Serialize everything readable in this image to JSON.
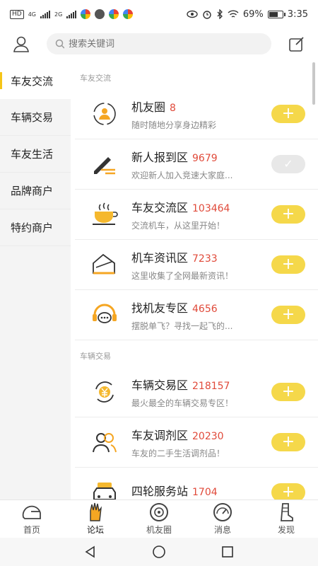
{
  "status_bar": {
    "left_chips": [
      "HD",
      "4G",
      "2G"
    ],
    "battery": "69%",
    "battery_level": 0.69,
    "time": "3:35"
  },
  "search": {
    "placeholder": "搜索关键词"
  },
  "sidebar": {
    "items": [
      {
        "label": "车友交流",
        "active": true
      },
      {
        "label": "车辆交易",
        "active": false
      },
      {
        "label": "车友生活",
        "active": false
      },
      {
        "label": "品牌商户",
        "active": false
      },
      {
        "label": "特约商户",
        "active": false
      }
    ]
  },
  "sections": [
    {
      "title": "车友交流",
      "rows": [
        {
          "name": "机友圈",
          "count": "8",
          "desc": "随时随地分享身边精彩",
          "icon": "users-circle-icon",
          "joined": false
        },
        {
          "name": "新人报到区",
          "count": "9679",
          "desc": "欢迎新人加入竞速大家庭...",
          "icon": "pencil-icon",
          "joined": true
        },
        {
          "name": "车友交流区",
          "count": "103464",
          "desc": "交流机车，从这里开始！",
          "icon": "coffee-cup-icon",
          "joined": false
        },
        {
          "name": "机车资讯区",
          "count": "7233",
          "desc": "这里收集了全网最新资讯！",
          "icon": "envelope-icon",
          "joined": false
        },
        {
          "name": "找机友专区",
          "count": "4656",
          "desc": "摆脱单飞？寻找一起飞的...",
          "icon": "chat-headset-icon",
          "joined": false
        }
      ]
    },
    {
      "title": "车辆交易",
      "rows": [
        {
          "name": "车辆交易区",
          "count": "218157",
          "desc": "最火最全的车辆交易专区！",
          "icon": "yen-exchange-icon",
          "joined": false
        },
        {
          "name": "车友调剂区",
          "count": "20230",
          "desc": "车友的二手生活调剂品！",
          "icon": "two-users-icon",
          "joined": false
        },
        {
          "name": "四轮服务站",
          "count": "1704",
          "desc": "",
          "icon": "car-icon",
          "joined": false
        }
      ]
    }
  ],
  "buttons": {
    "add": "+",
    "joined": "✓"
  },
  "tabbar": {
    "items": [
      {
        "label": "首页",
        "icon": "helmet-icon"
      },
      {
        "label": "论坛",
        "icon": "glove-icon"
      },
      {
        "label": "机友圈",
        "icon": "tire-icon"
      },
      {
        "label": "消息",
        "icon": "speedometer-icon"
      },
      {
        "label": "发现",
        "icon": "boot-icon"
      }
    ]
  },
  "colors": {
    "accent": "#f5c518",
    "count": "#e04a3a",
    "pill": "#f5d84a"
  }
}
